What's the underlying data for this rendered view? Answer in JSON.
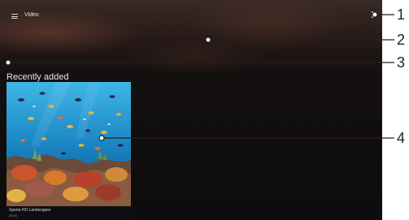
{
  "app_bar": {
    "menu_icon": "menu-icon",
    "title": "Video",
    "overflow_icon": "more-vert-icon"
  },
  "recent": {
    "section_title": "Recently added",
    "items": [
      {
        "title": "Xperia HD Landscapes",
        "subtitle": "00:00",
        "thumbnail": "underwater coral reef with fish"
      }
    ]
  },
  "callouts": {
    "items": [
      {
        "number": "1"
      },
      {
        "number": "2"
      },
      {
        "number": "3"
      },
      {
        "number": "4"
      }
    ]
  },
  "colors": {
    "screen_background": "#120b0a",
    "callout_line": "#222222"
  }
}
